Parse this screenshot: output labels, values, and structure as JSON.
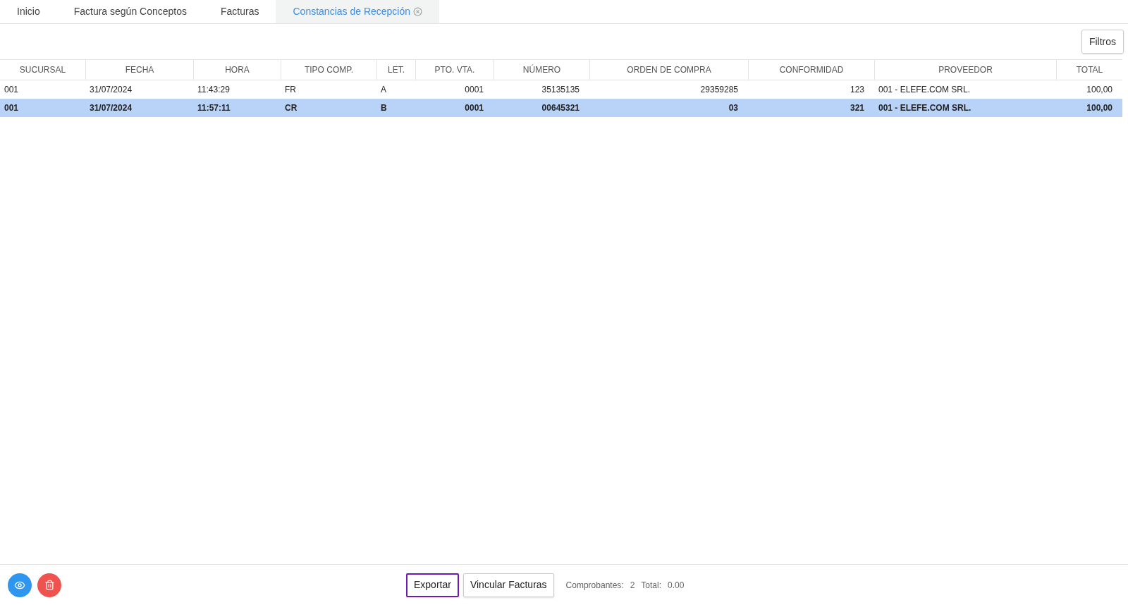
{
  "tabs": [
    {
      "label": "Inicio",
      "selected": false
    },
    {
      "label": "Factura según Conceptos",
      "selected": false
    },
    {
      "label": "Facturas",
      "selected": false
    },
    {
      "label": "Constancias de Recepción",
      "selected": true
    }
  ],
  "toolbar": {
    "filter_button": "Filtros"
  },
  "table": {
    "columns": [
      {
        "label": "SUCURSAL"
      },
      {
        "label": "FECHA"
      },
      {
        "label": "HORA"
      },
      {
        "label": "TIPO COMP."
      },
      {
        "label": "LET."
      },
      {
        "label": "PTO. VTA."
      },
      {
        "label": "NÚMERO"
      },
      {
        "label": "ORDEN DE COMPRA"
      },
      {
        "label": "CONFORMIDAD"
      },
      {
        "label": "PROVEEDOR"
      },
      {
        "label": "TOTAL"
      }
    ],
    "rows": [
      {
        "selected": false,
        "cells": [
          "001",
          "31/07/2024",
          "11:43:29",
          "FR",
          "A",
          "0001",
          "35135135",
          "29359285",
          "123",
          "001 - ELEFE.COM SRL.",
          "100,00"
        ]
      },
      {
        "selected": true,
        "cells": [
          "001",
          "31/07/2024",
          "11:57:11",
          "CR",
          "B",
          "0001",
          "00645321",
          "03",
          "321",
          "001 - ELEFE.COM SRL.",
          "100,00"
        ]
      }
    ]
  },
  "footer": {
    "icon_buttons": [
      {
        "kind": "view"
      },
      {
        "kind": "delete"
      }
    ],
    "buttons": [
      {
        "label": "Exportar",
        "focused": true
      },
      {
        "label": "Vincular Facturas",
        "focused": false
      }
    ],
    "summary": [
      {
        "label": "Comprobantes:",
        "value": "2"
      },
      {
        "label": "Total:",
        "value": "0.00"
      }
    ]
  }
}
